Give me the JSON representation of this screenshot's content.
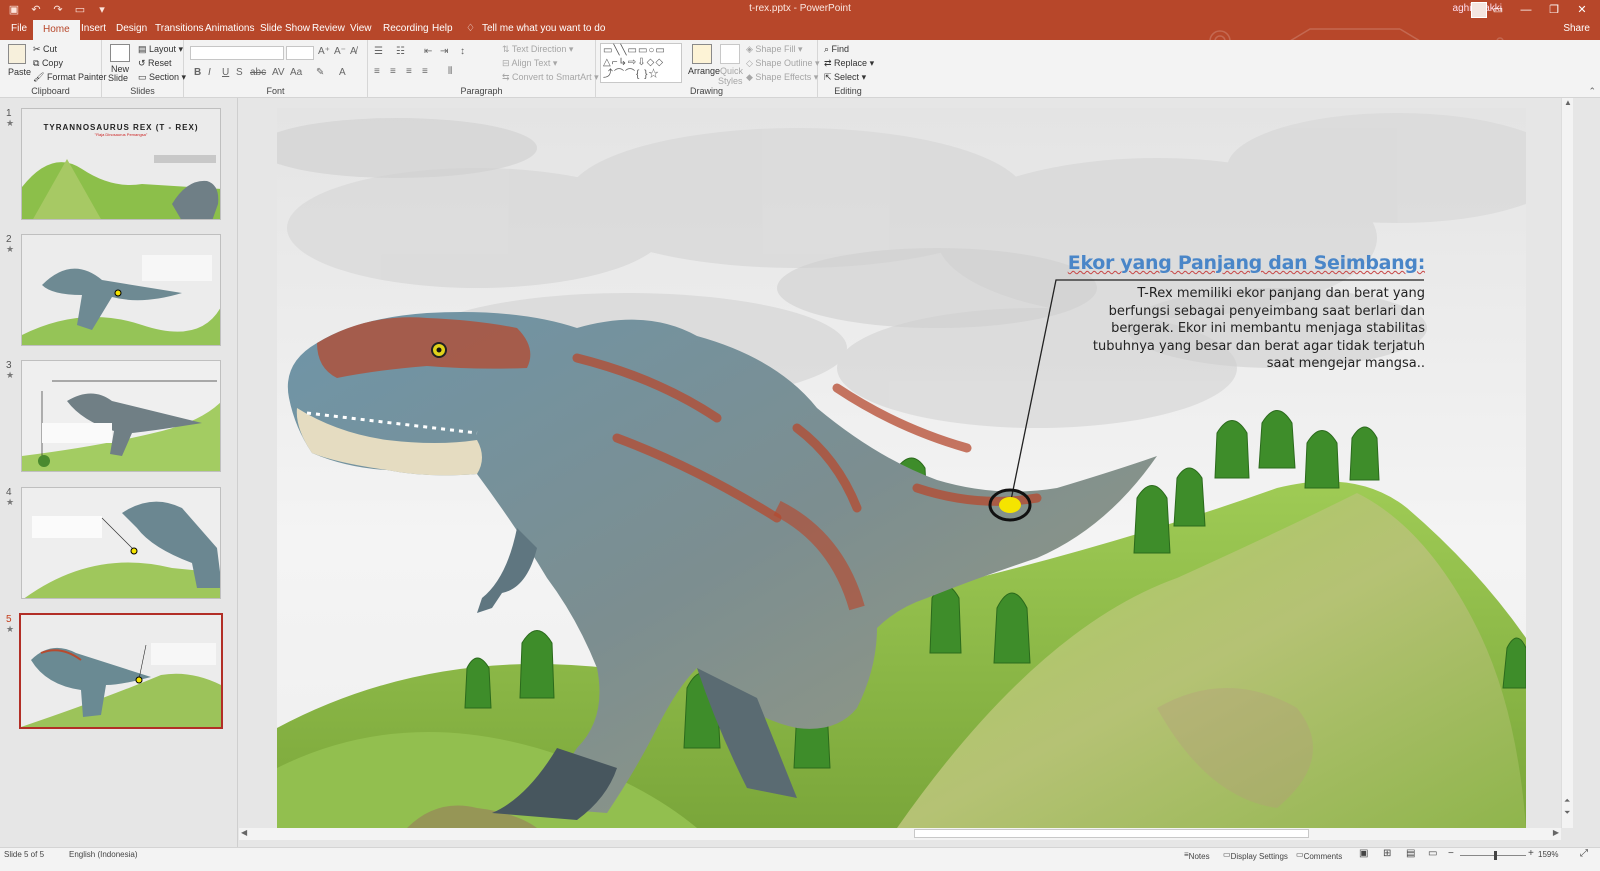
{
  "window": {
    "title": "t-rex.pptx  -  PowerPoint",
    "user": "aghis zakki"
  },
  "tabs": [
    "File",
    "Home",
    "Insert",
    "Design",
    "Transitions",
    "Animations",
    "Slide Show",
    "Review",
    "View",
    "Recording",
    "Help"
  ],
  "active_tab": "Home",
  "tell_me": "Tell me what you want to do",
  "share": "Share",
  "ribbon": {
    "clipboard": {
      "label": "Clipboard",
      "paste": "Paste",
      "cut": "Cut",
      "copy": "Copy",
      "format_painter": "Format Painter"
    },
    "slides": {
      "label": "Slides",
      "new_slide": "New",
      "new_slide2": "Slide",
      "layout": "Layout",
      "reset": "Reset",
      "section": "Section"
    },
    "font": {
      "label": "Font"
    },
    "paragraph": {
      "label": "Paragraph",
      "text_direction": "Text Direction",
      "align_text": "Align Text",
      "smartart": "Convert to SmartArt"
    },
    "drawing": {
      "label": "Drawing",
      "arrange": "Arrange",
      "quick_styles": "Quick",
      "quick_styles2": "Styles",
      "shape_fill": "Shape Fill",
      "shape_outline": "Shape Outline",
      "shape_effects": "Shape Effects"
    },
    "editing": {
      "label": "Editing",
      "find": "Find",
      "replace": "Replace",
      "select": "Select"
    }
  },
  "thumbnails": [
    {
      "num": "1",
      "title": "TYRANNOSAURUS REX (T - REX)",
      "subtitle": "\"Raja Dinosaurus Pemangsa\""
    },
    {
      "num": "2"
    },
    {
      "num": "3"
    },
    {
      "num": "4"
    },
    {
      "num": "5"
    }
  ],
  "slide": {
    "heading": "Ekor yang Panjang dan Seimbang:",
    "body_lines": [
      "T-Rex memiliki ekor panjang dan berat yang",
      "berfungsi sebagai penyeimbang saat berlari dan",
      "bergerak. Ekor ini membantu menjaga stabilitas",
      "tubuhnya yang besar dan berat agar tidak terjatuh",
      "saat mengejar mangsa.."
    ]
  },
  "status": {
    "slide_count": "Slide 5 of 5",
    "language": "English (Indonesia)",
    "notes": "Notes",
    "display_settings": "Display Settings",
    "comments": "Comments",
    "zoom": "159%"
  },
  "colors": {
    "accent": "#b7472a",
    "heading": "#4a86c8",
    "marker": "#f5e400"
  }
}
